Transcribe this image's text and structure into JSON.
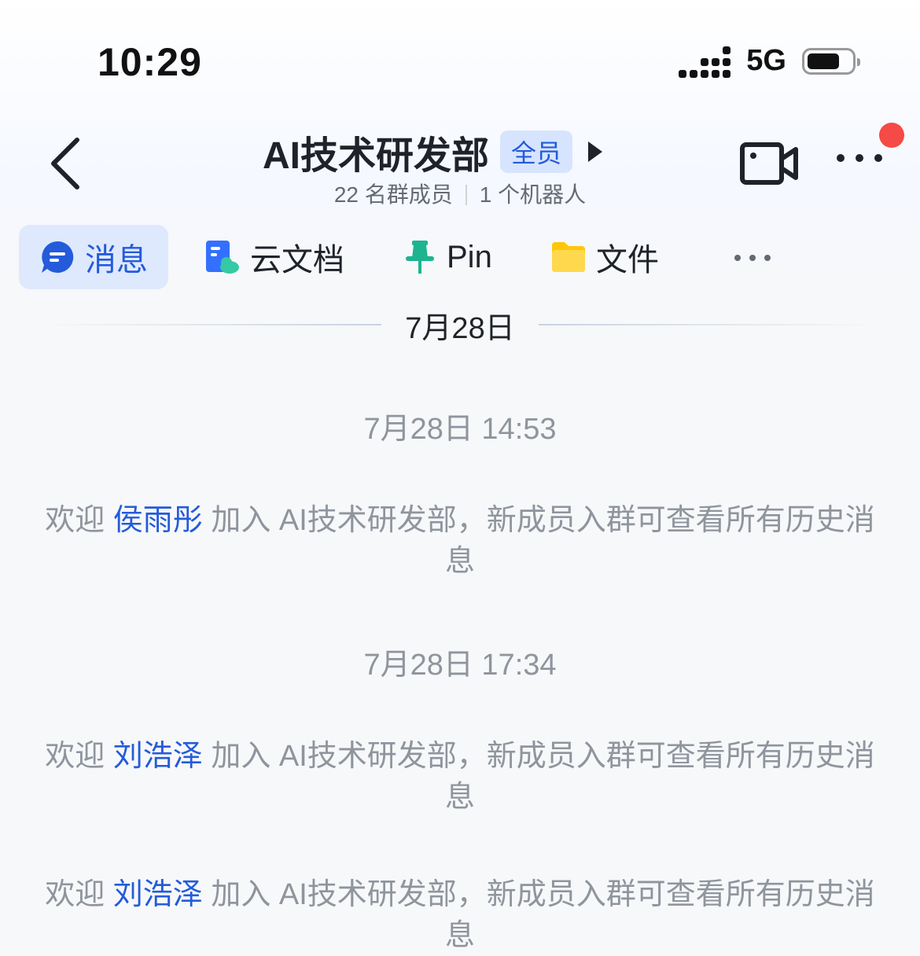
{
  "status_bar": {
    "time": "10:29",
    "network": "5G"
  },
  "header": {
    "title": "AI技术研发部",
    "badge": "全员",
    "member_count": "22 名群成员",
    "bot_count": "1 个机器人"
  },
  "tabs": [
    {
      "label": "消息",
      "icon": "message-icon"
    },
    {
      "label": "云文档",
      "icon": "cloud-doc-icon"
    },
    {
      "label": "Pin",
      "icon": "pin-icon"
    },
    {
      "label": "文件",
      "icon": "folder-icon"
    }
  ],
  "date_divider": "7月28日",
  "messages": [
    {
      "timestamp": "7月28日 14:53"
    },
    {
      "prefix": "欢迎 ",
      "name": "侯雨彤",
      "suffix": " 加入 AI技术研发部，新成员入群可查看所有历史消息"
    },
    {
      "timestamp": "7月28日 17:34"
    },
    {
      "prefix": "欢迎 ",
      "name": "刘浩泽",
      "suffix": " 加入 AI技术研发部，新成员入群可查看所有历史消息"
    },
    {
      "prefix": "欢迎 ",
      "name": "刘浩泽",
      "suffix": " 加入 AI技术研发部，新成员入群可查看所有历史消息"
    }
  ],
  "colors": {
    "accent": "#245bdb",
    "muted": "#8f959e",
    "notification": "#f54a45"
  }
}
